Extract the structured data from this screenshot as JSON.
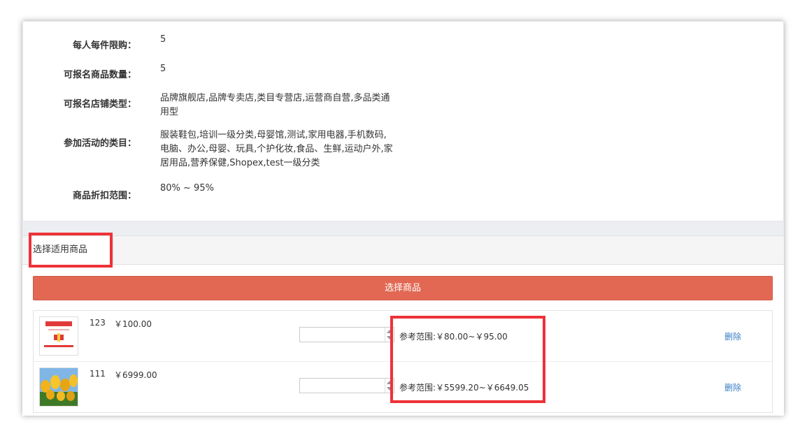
{
  "info": [
    {
      "label": "每人每件限购：",
      "value": "5"
    },
    {
      "label": "可报名商品数量：",
      "value": "5"
    },
    {
      "label": "可报名店铺类型：",
      "value": "品牌旗舰店,品牌专卖店,类目专营店,运营商自营,多品类通用型"
    },
    {
      "label": "参加活动的类目：",
      "value": "服装鞋包,培训一级分类,母婴馆,测试,家用电器,手机数码,电脑、办公,母婴、玩具,个护化妆,食品、生鲜,运动户外,家居用品,营养保健,Shopex,test一级分类"
    },
    {
      "label": "商品折扣范围：",
      "value": "80% ~ 95%"
    }
  ],
  "section": {
    "tab_label": "选择适用商品",
    "select_button": "选择商品"
  },
  "products": [
    {
      "name": "123",
      "price": "￥100.00",
      "input_value": "",
      "range": "参考范围:￥80.00~￥95.00",
      "delete_label": "删除",
      "thumb": "red-coupon-image"
    },
    {
      "name": "111",
      "price": "￥6999.00",
      "input_value": "",
      "range": "参考范围:￥5599.20~￥6649.05",
      "delete_label": "删除",
      "thumb": "tulip-photo"
    }
  ],
  "colors": {
    "accent_button": "#e26853",
    "link": "#3a7fc4",
    "highlight_box": "#ee3238"
  }
}
